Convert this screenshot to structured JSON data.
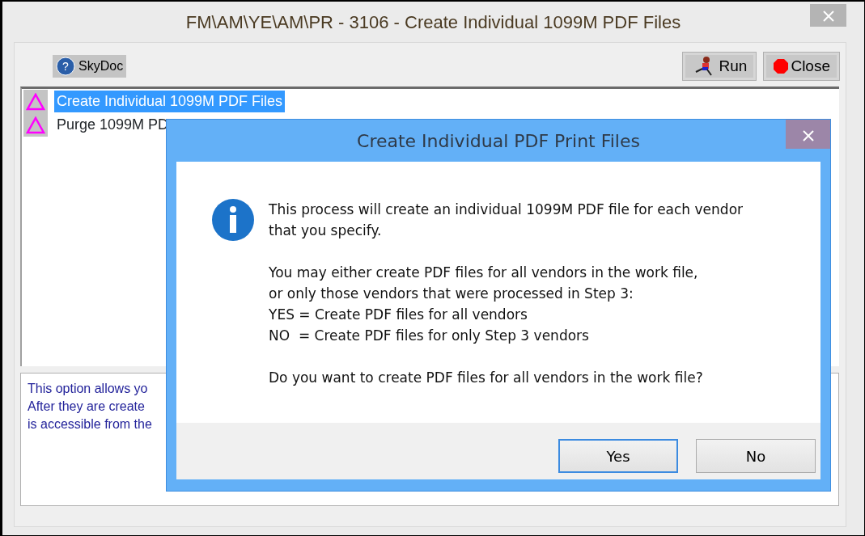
{
  "window": {
    "title": "FM\\AM\\YE\\AM\\PR - 3106 - Create Individual 1099M PDF Files"
  },
  "toolbar": {
    "help_button": "SkyDoc",
    "help_glyph": "?",
    "buttons": [
      {
        "label": "Run",
        "kind": "run"
      },
      {
        "label": "Close",
        "kind": "stop"
      }
    ]
  },
  "list": {
    "items": [
      {
        "label": "Create Individual 1099M PDF Files",
        "selected": true
      },
      {
        "label": "Purge 1099M PD",
        "selected": false
      }
    ]
  },
  "description": {
    "lines": [
      "This option allows yo",
      "After they are create",
      "is accessible from the"
    ]
  },
  "dialog": {
    "title": "Create Individual PDF Print Files",
    "paragraphs": [
      [
        "This process will create an individual 1099M PDF file for each vendor",
        "that you specify."
      ],
      [
        "You may either create PDF files for all vendors in the work file,",
        "or only those vendors that were processed in Step 3:",
        "YES = Create PDF files for all vendors",
        "NO  = Create PDF files for only Step 3 vendors"
      ],
      [
        "Do you want to create PDF files for all vendors in the work file?"
      ]
    ],
    "buttons": [
      {
        "label": "Yes",
        "selected": true
      },
      {
        "label": "No",
        "selected": false
      }
    ]
  }
}
